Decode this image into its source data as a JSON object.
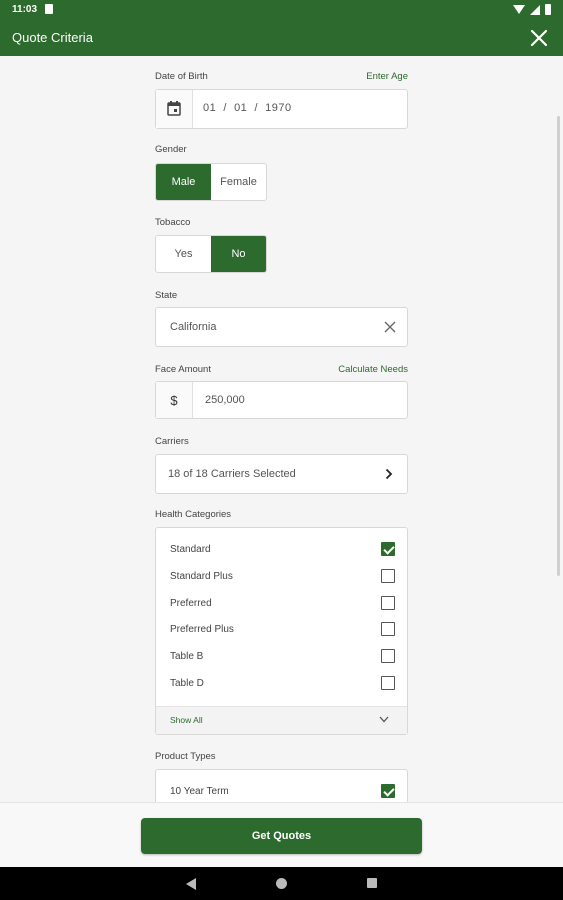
{
  "status_bar": {
    "time": "11:03"
  },
  "app_bar": {
    "title": "Quote Criteria"
  },
  "dob": {
    "label": "Date of Birth",
    "link": "Enter Age",
    "month": "01",
    "day": "01",
    "year": "1970",
    "separator": "/"
  },
  "gender": {
    "label": "Gender",
    "options": [
      "Male",
      "Female"
    ],
    "selected": "Male"
  },
  "tobacco": {
    "label": "Tobacco",
    "options": [
      "Yes",
      "No"
    ],
    "selected": "No"
  },
  "state": {
    "label": "State",
    "value": "California"
  },
  "face_amount": {
    "label": "Face Amount",
    "link": "Calculate Needs",
    "prefix": "$",
    "value": "250,000"
  },
  "carriers": {
    "label": "Carriers",
    "value": "18 of 18 Carriers Selected"
  },
  "health_categories": {
    "label": "Health Categories",
    "items": [
      {
        "label": "Standard",
        "checked": true
      },
      {
        "label": "Standard Plus",
        "checked": false
      },
      {
        "label": "Preferred",
        "checked": false
      },
      {
        "label": "Preferred Plus",
        "checked": false
      },
      {
        "label": "Table B",
        "checked": false
      },
      {
        "label": "Table D",
        "checked": false
      }
    ],
    "show_all": "Show All"
  },
  "product_types": {
    "label": "Product Types",
    "items": [
      {
        "label": "10 Year Term",
        "checked": true
      }
    ]
  },
  "footer": {
    "button": "Get Quotes"
  },
  "colors": {
    "primary": "#2d6a2d",
    "background": "#f5f5f5"
  }
}
